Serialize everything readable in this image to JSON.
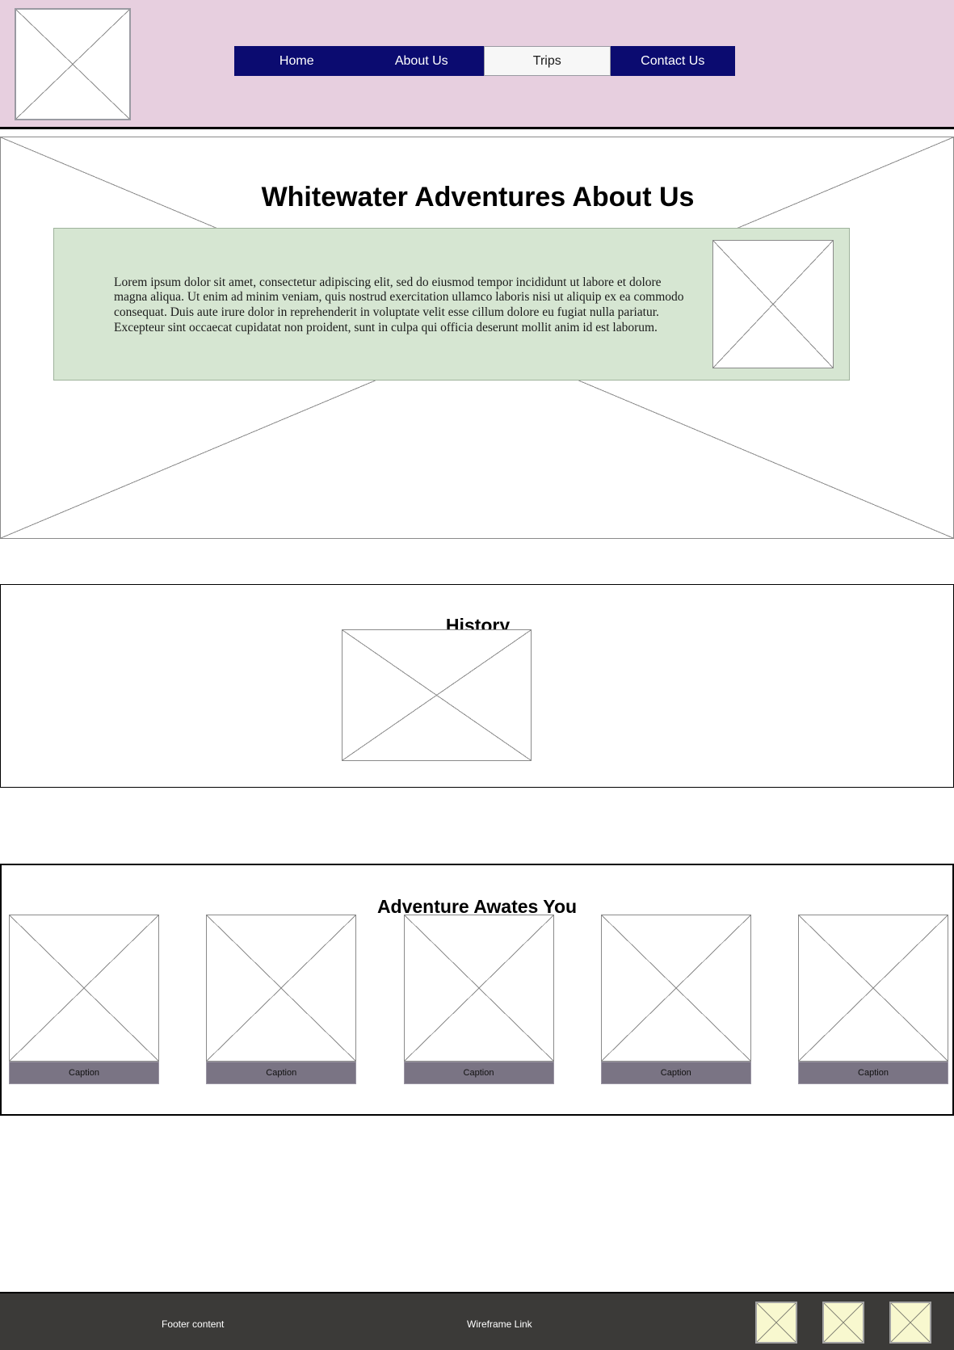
{
  "header": {
    "background_color": "#e7cfdf",
    "logo_placeholder": "logo-image-placeholder",
    "nav": {
      "background_color": "#0b0b70",
      "active_item_background": "#f7f7f7",
      "items": [
        {
          "label": "Home",
          "active": false
        },
        {
          "label": "About Us",
          "active": false
        },
        {
          "label": "Trips",
          "active": true
        },
        {
          "label": "Contact Us",
          "active": false
        }
      ]
    }
  },
  "about": {
    "title": "Whitewater Adventures About Us",
    "card_background_color": "#d6e6d2",
    "body_text": "Lorem ipsum dolor sit amet, consectetur adipiscing elit, sed do eiusmod tempor incididunt ut labore et dolore magna aliqua. Ut enim ad minim veniam, quis nostrud exercitation ullamco laboris nisi ut aliquip ex ea commodo consequat. Duis aute irure dolor in reprehenderit in voluptate velit esse cillum dolore eu fugiat nulla pariatur. Excepteur sint occaecat cupidatat non proident, sunt in culpa qui officia deserunt mollit anim id est laborum.",
    "side_image_placeholder": "about-side-image-placeholder"
  },
  "history": {
    "title": "History",
    "image_placeholder": "history-image-placeholder"
  },
  "gallery": {
    "title": "Adventure Awates You",
    "caption_background_color": "#7a7484",
    "cards": [
      {
        "caption": "Caption"
      },
      {
        "caption": "Caption"
      },
      {
        "caption": "Caption"
      },
      {
        "caption": "Caption"
      },
      {
        "caption": "Caption"
      }
    ]
  },
  "footer": {
    "background_color": "#3b3a38",
    "content_label": "Footer content",
    "link_label": "Wireframe Link",
    "icon_color": "#f8f8cf",
    "icons": [
      {
        "name": "footer-image-placeholder-1"
      },
      {
        "name": "footer-image-placeholder-2"
      },
      {
        "name": "footer-image-placeholder-3"
      }
    ]
  }
}
